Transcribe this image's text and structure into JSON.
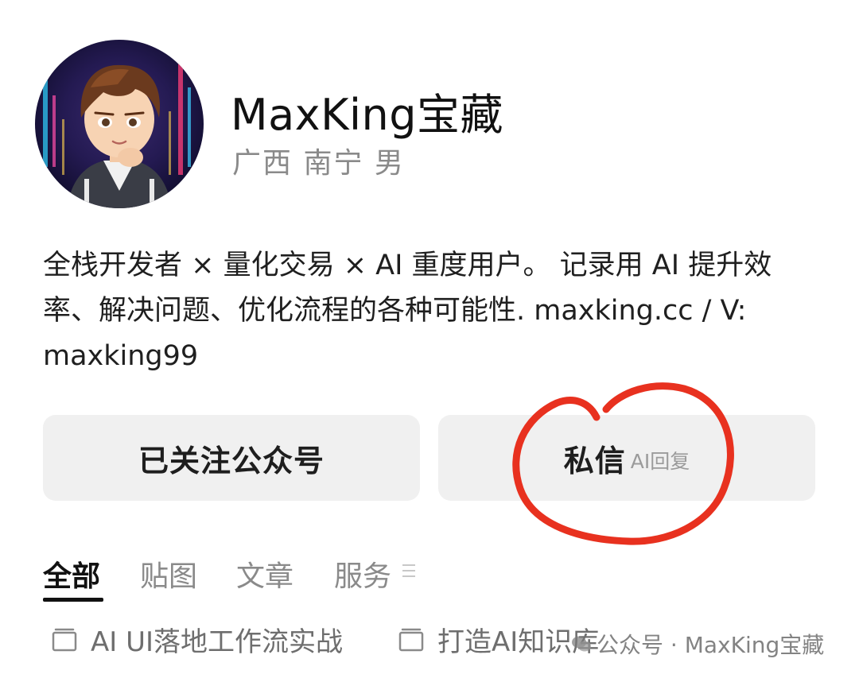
{
  "profile": {
    "name": "MaxKing宝藏",
    "meta": "广西 南宁 男",
    "bio_line1": "全栈开发者 × 量化交易 × AI 重度用户。 记录用 AI 提升效",
    "bio_line2": "率、解决问题、优化流程的各种可能性. maxking.cc / V:",
    "bio_line3": "maxking99"
  },
  "actions": {
    "follow_label": "已关注公众号",
    "message_label": "私信",
    "message_sub": "AI回复"
  },
  "tabs": [
    {
      "label": "全部",
      "active": true
    },
    {
      "label": "贴图",
      "active": false
    },
    {
      "label": "文章",
      "active": false
    },
    {
      "label": "服务",
      "active": false
    }
  ],
  "collections": [
    {
      "label": "AI UI落地工作流实战",
      "icon": "folder-icon"
    },
    {
      "label": "打造AI知识库",
      "icon": "folder-icon"
    }
  ],
  "watermark": "公众号 · MaxKing宝藏",
  "colors": {
    "annotation_circle": "#e8311f",
    "button_bg": "#f0f0f0",
    "muted_text": "#8a8a8a"
  }
}
